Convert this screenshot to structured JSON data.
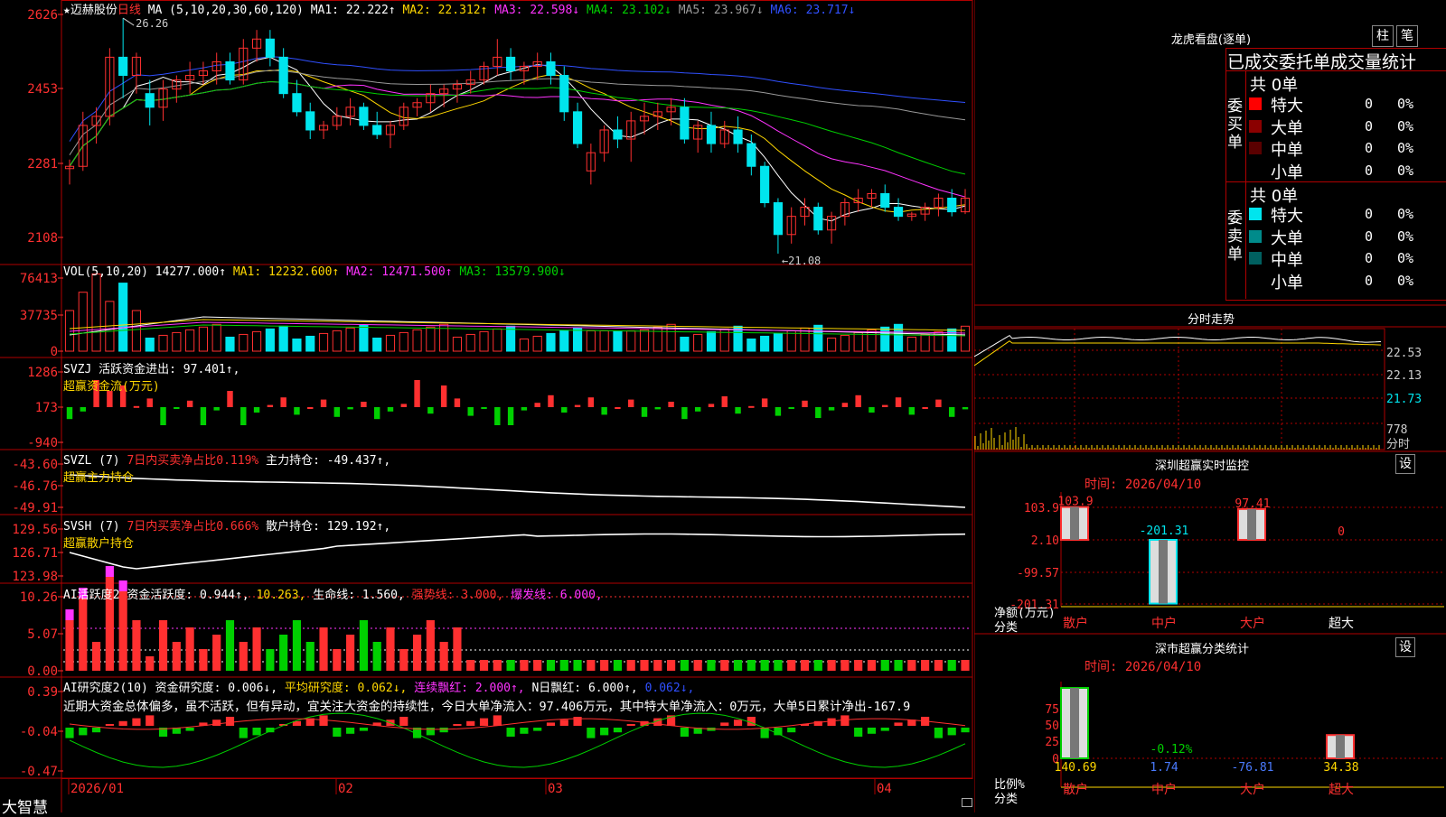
{
  "colors": {
    "up": "#ff3030",
    "down": "#00e5ee",
    "green": "#00d000",
    "frame": "#b00000",
    "yellow": "#ffd700",
    "magenta": "#ff33ff",
    "white": "#ffffff",
    "gray": "#999999",
    "blue": "#3050ff"
  },
  "stock": {
    "name": "迈赫股份",
    "period": "日线",
    "ma_label": "MA (5,10,20,30,60,120)",
    "ma_items": [
      {
        "t": "MA1: 22.222↑",
        "c": "#ffffff"
      },
      {
        "t": "MA2: 22.312↑",
        "c": "#ffd700"
      },
      {
        "t": "MA3: 22.598↓",
        "c": "#ff33ff"
      },
      {
        "t": "MA4: 23.102↓",
        "c": "#00d000"
      },
      {
        "t": "MA5: 23.967↓",
        "c": "#999999"
      },
      {
        "t": "MA6: 23.717↓",
        "c": "#3050ff"
      }
    ],
    "star": "★"
  },
  "vol_header": {
    "label": "VOL(5,10,20)",
    "value": "14277.000↑",
    "items": [
      {
        "t": "MA1: 12232.600↑",
        "c": "#ffd700"
      },
      {
        "t": "MA2: 12471.500↑",
        "c": "#ff33ff"
      },
      {
        "t": "MA3: 13579.900↓",
        "c": "#00d000"
      }
    ]
  },
  "svzj_header": {
    "t1": "SVZJ  活跃资金进出: 97.401↑,",
    "t2": "超赢资金流(万元)"
  },
  "svzl_header": {
    "t1": "SVZL (7)",
    "t2": "7日内买卖净占比0.119%",
    "t3": "主力持仓: -49.437↑,",
    "t4": "超赢主力持仓"
  },
  "svsh_header": {
    "t1": "SVSH (7)",
    "t2": "7日内买卖净占比0.666%",
    "t3": "散户持仓: 129.192↑,",
    "t4": "超赢散户持仓"
  },
  "ai1_header": {
    "t1": "AI活跃度2",
    "t2": "资金活跃度: 0.944↑,",
    "t3": "10.263,",
    "t4": "生命线: 1.560,",
    "t5": "强势线: 3.000,",
    "t6": "爆发线: 6.000,"
  },
  "ai2_header": {
    "t1": "AI研究度2(10)",
    "t2": "资金研究度: 0.006↓,",
    "t3": "平均研究度: 0.062↓,",
    "t4": "连续飘红: 2.000↑,",
    "t5": "N日飘红: 6.000↑,",
    "t6": "0.062↓,"
  },
  "commentary": "近期大资金总体偏多，虽不活跃，但有异动，宜关注大资金的持续性，今日大单净流入：97.406万元，其中特大单净流入：0万元，大单5日累计净出-167.9",
  "axis_labels": {
    "price": [
      "2626",
      "2453",
      "2281",
      "2108"
    ],
    "vol": [
      "76413",
      "37735",
      "0"
    ],
    "svzj": [
      "1286",
      "173",
      "-940"
    ],
    "svzl": [
      "-43.60",
      "-46.76",
      "-49.91"
    ],
    "svsh": [
      "129.56",
      "126.71",
      "123.98"
    ],
    "ai1": [
      "10.26",
      "5.07",
      "0.00"
    ],
    "ai2": [
      "0.39",
      "-0.04",
      "-0.47"
    ]
  },
  "price_annotations": {
    "high": "26.26",
    "low": "←21.08"
  },
  "dates": [
    "2026/01",
    "02",
    "03",
    "04"
  ],
  "footer_brand": "大智慧",
  "right": {
    "longhu_title": "龙虎看盘(逐单)",
    "btn1": "柱",
    "btn2": "笔",
    "subtitle": "已成交委托单成交量统计",
    "buy_label": "委买单",
    "sell_label": "委卖单",
    "buy_total": "共 0单",
    "sell_total": "共 0单",
    "buy_rows": [
      {
        "name": "特大",
        "color": "#ff0000",
        "v": "0",
        "p": "0%"
      },
      {
        "name": "大单",
        "color": "#8b0000",
        "v": "0",
        "p": "0%"
      },
      {
        "name": "中单",
        "color": "#5a0000",
        "v": "0",
        "p": "0%"
      },
      {
        "name": "小单",
        "color": "#000000",
        "v": "0",
        "p": "0%"
      }
    ],
    "sell_rows": [
      {
        "name": "特大",
        "color": "#00e5ee",
        "v": "0",
        "p": "0%"
      },
      {
        "name": "大单",
        "color": "#008b8b",
        "v": "0",
        "p": "0%"
      },
      {
        "name": "中单",
        "color": "#006060",
        "v": "0",
        "p": "0%"
      },
      {
        "name": "小单",
        "color": "#000000",
        "v": "0",
        "p": "0%"
      }
    ],
    "fenshi_title": "分时走势",
    "fenshi_axis": [
      "22.53",
      "22.13",
      "21.73",
      "778",
      "分时"
    ],
    "monitor_title": "深圳超赢实时监控",
    "set1": "设",
    "monitor_time": "时间: 2026/04/10",
    "monitor_axis": [
      "103.9",
      "2.10",
      "-99.57",
      "-201.31"
    ],
    "monitor_unit": "净额(万元)",
    "monitor_cat": "分类",
    "monitor_bars": [
      {
        "label": "散户",
        "value": 103.9,
        "text": "103.9"
      },
      {
        "label": "中户",
        "value": -201.31,
        "text": "-201.31"
      },
      {
        "label": "大户",
        "value": 97.41,
        "text": "97.41"
      },
      {
        "label": "超大",
        "value": 0,
        "text": "0"
      }
    ],
    "class_title": "深市超赢分类统计",
    "set2": "设",
    "class_time": "时间: 2026/04/10",
    "class_axis": [
      "75",
      "50",
      "25",
      "0"
    ],
    "class_unit": "比例%",
    "class_cat": "分类",
    "class_bars": [
      {
        "label": "散户",
        "value": 140.69,
        "text": "140.69"
      },
      {
        "label": "中户",
        "value": 1.74,
        "text": "1.74"
      },
      {
        "label": "大户",
        "value": -76.81,
        "text": "-76.81"
      },
      {
        "label": "超大",
        "value": 34.38,
        "text": "34.38"
      }
    ],
    "class_note": "-0.12%"
  },
  "chart_data": {
    "type": "candlestick",
    "title": "迈赫股份 日线",
    "price_range": [
      21.08,
      26.26
    ],
    "candles": [
      [
        22.95,
        23.15,
        22.6,
        23.0
      ],
      [
        23.0,
        24.2,
        22.9,
        23.9
      ],
      [
        23.9,
        24.3,
        23.5,
        24.1
      ],
      [
        24.1,
        25.6,
        23.9,
        25.4
      ],
      [
        25.4,
        26.26,
        24.5,
        25.0
      ],
      [
        25.0,
        25.5,
        24.6,
        25.4
      ],
      [
        24.6,
        24.9,
        23.9,
        24.3
      ],
      [
        24.3,
        24.9,
        24.0,
        24.7
      ],
      [
        24.7,
        25.0,
        24.4,
        24.9
      ],
      [
        24.9,
        25.3,
        24.6,
        25.0
      ],
      [
        25.0,
        25.3,
        24.8,
        25.1
      ],
      [
        25.1,
        25.5,
        24.8,
        25.3
      ],
      [
        25.3,
        25.5,
        24.8,
        24.9
      ],
      [
        24.9,
        25.8,
        24.8,
        25.6
      ],
      [
        25.6,
        26.0,
        25.3,
        25.8
      ],
      [
        25.8,
        26.0,
        25.2,
        25.4
      ],
      [
        25.4,
        25.6,
        24.5,
        24.6
      ],
      [
        24.6,
        24.9,
        24.1,
        24.2
      ],
      [
        24.2,
        24.4,
        23.6,
        23.8
      ],
      [
        23.8,
        24.0,
        23.6,
        23.9
      ],
      [
        23.9,
        24.3,
        23.8,
        24.1
      ],
      [
        24.1,
        24.5,
        23.9,
        24.3
      ],
      [
        24.3,
        24.4,
        23.8,
        23.9
      ],
      [
        23.9,
        24.2,
        23.6,
        23.7
      ],
      [
        23.7,
        24.0,
        23.4,
        23.9
      ],
      [
        23.9,
        24.4,
        23.8,
        24.3
      ],
      [
        24.3,
        24.5,
        24.1,
        24.4
      ],
      [
        24.4,
        24.8,
        24.2,
        24.6
      ],
      [
        24.6,
        24.8,
        24.3,
        24.7
      ],
      [
        24.7,
        24.9,
        24.4,
        24.8
      ],
      [
        24.8,
        25.1,
        24.6,
        24.9
      ],
      [
        24.9,
        25.3,
        24.8,
        25.2
      ],
      [
        25.2,
        25.8,
        25.0,
        25.4
      ],
      [
        25.4,
        25.6,
        24.9,
        25.1
      ],
      [
        25.1,
        25.3,
        24.8,
        25.2
      ],
      [
        25.2,
        25.5,
        24.9,
        25.3
      ],
      [
        25.3,
        25.5,
        24.8,
        25.0
      ],
      [
        25.0,
        25.2,
        24.0,
        24.2
      ],
      [
        24.2,
        24.4,
        23.4,
        23.5
      ],
      [
        22.9,
        23.5,
        22.6,
        23.3
      ],
      [
        23.3,
        23.9,
        23.1,
        23.8
      ],
      [
        23.8,
        24.1,
        23.4,
        23.6
      ],
      [
        23.6,
        24.2,
        23.1,
        24.0
      ],
      [
        24.0,
        24.4,
        23.7,
        24.1
      ],
      [
        24.1,
        24.4,
        23.8,
        24.2
      ],
      [
        24.2,
        24.5,
        23.9,
        24.3
      ],
      [
        24.3,
        24.5,
        23.5,
        23.6
      ],
      [
        23.6,
        24.0,
        23.3,
        23.9
      ],
      [
        23.9,
        24.2,
        23.3,
        23.5
      ],
      [
        23.5,
        24.0,
        23.4,
        23.8
      ],
      [
        23.8,
        24.1,
        23.3,
        23.5
      ],
      [
        23.5,
        23.7,
        22.8,
        23.0
      ],
      [
        23.0,
        23.1,
        22.1,
        22.2
      ],
      [
        22.2,
        22.3,
        21.08,
        21.5
      ],
      [
        21.5,
        22.1,
        21.3,
        21.9
      ],
      [
        21.9,
        22.3,
        21.7,
        22.1
      ],
      [
        22.1,
        22.2,
        21.5,
        21.6
      ],
      [
        21.6,
        22.0,
        21.3,
        21.9
      ],
      [
        21.9,
        22.3,
        21.7,
        22.2
      ],
      [
        22.2,
        22.5,
        22.0,
        22.3
      ],
      [
        22.3,
        22.5,
        22.1,
        22.4
      ],
      [
        22.4,
        22.6,
        22.0,
        22.1
      ],
      [
        22.1,
        22.3,
        21.8,
        21.9
      ],
      [
        21.9,
        22.0,
        21.8,
        21.95
      ],
      [
        21.95,
        22.2,
        21.8,
        22.1
      ],
      [
        22.1,
        22.4,
        21.9,
        22.3
      ],
      [
        22.3,
        22.5,
        21.9,
        22.0
      ],
      [
        22.0,
        22.5,
        21.95,
        22.3
      ]
    ]
  }
}
